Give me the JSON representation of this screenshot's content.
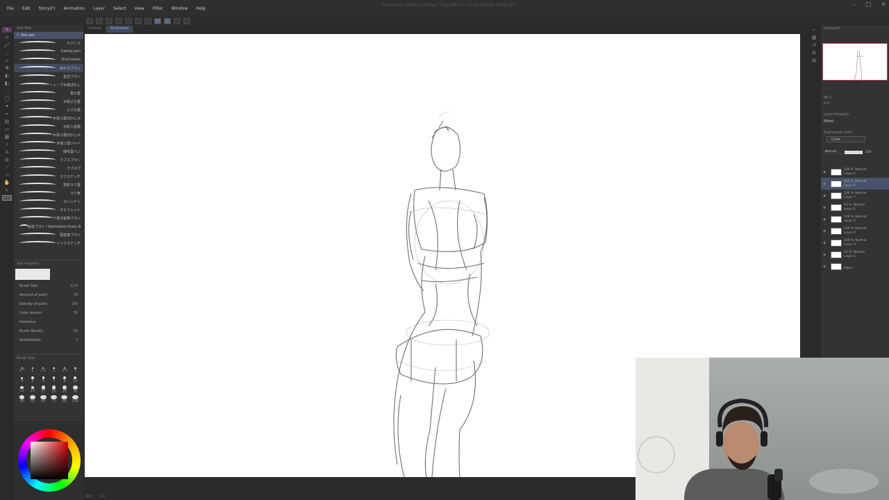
{
  "menu": {
    "items": [
      "File",
      "Edit",
      "Story(F)",
      "Animation",
      "Layer",
      "Select",
      "View",
      "Filter",
      "Window",
      "Help"
    ]
  },
  "window": {
    "title": "Illustration 1664 x 1784px 72dpi 88.7% - CLIP STUDIO PAINT EX"
  },
  "tabs": [
    "Untitled",
    "Illustration"
  ],
  "subtool": {
    "header": "Sub Tool",
    "selected": "Dot pen",
    "brushes": [
      {
        "name": "ネクシス"
      },
      {
        "name": "Gwang pen"
      },
      {
        "name": "DryClumps"
      },
      {
        "name": "ぬれホブラシ",
        "active": true
      },
      {
        "name": "星空ブラシ"
      },
      {
        "name": "シャープ木炭ぼかし"
      },
      {
        "name": "雲の雲"
      },
      {
        "name": "木炭ぶち雲"
      },
      {
        "name": "小さな雲"
      },
      {
        "name": "木炭ぶ雲ぼかしみ"
      },
      {
        "name": "水彩入道雲"
      },
      {
        "name": "木炭ぶ雲ぼかしみ"
      },
      {
        "name": "木炭ぶ雲ジャイ"
      },
      {
        "name": "綿毛雲ペン"
      },
      {
        "name": "ラフスブラシ"
      },
      {
        "name": "ラフスプ"
      },
      {
        "name": "ラフスケッチ"
      },
      {
        "name": "草原ラフ雲"
      },
      {
        "name": "ラフ気"
      },
      {
        "name": "ラハッゲン"
      },
      {
        "name": "ラエフェット"
      },
      {
        "name": "下書き鉛筆ブラシ"
      },
      {
        "name": "鉄道ブラシ / Battlefield Dusts B"
      },
      {
        "name": "雲密度ブラシ"
      },
      {
        "name": "インクスケッチ"
      }
    ]
  },
  "toolprop": {
    "header": "Tool Property",
    "rows": [
      {
        "label": "Brush Size",
        "value": "12.0"
      },
      {
        "label": "Amount of paint",
        "value": "78"
      },
      {
        "label": "Density of paint",
        "value": "100"
      },
      {
        "label": "Color stretch",
        "value": "35"
      },
      {
        "label": "Hardness",
        "value": ""
      },
      {
        "label": "Brush density",
        "value": "50"
      },
      {
        "label": "Stabilization",
        "value": "3"
      }
    ]
  },
  "brushsize": {
    "header": "Brush Size",
    "sizes": [
      "0.7",
      "1",
      "1.5",
      "2",
      "2.5",
      "3",
      "4",
      "5",
      "6",
      "7",
      "8",
      "10",
      "12",
      "15",
      "17",
      "20",
      "25",
      "30",
      "40",
      "50",
      "60",
      "70",
      "80",
      "100"
    ]
  },
  "navigator": {
    "header": "Navigator",
    "zoom": "88.7",
    "angle": "0.0"
  },
  "layer_panel": {
    "property_header": "Layer Property",
    "effect": "Effect",
    "expression_label": "Expression color",
    "expression_value": "Color",
    "blend_mode": "Normal",
    "opacity": "100",
    "layers": [
      {
        "opacity": "100 %",
        "mode": "Normal",
        "name": "Layer 2"
      },
      {
        "opacity": "100 %",
        "mode": "Normal",
        "name": "Layer 8",
        "active": true
      },
      {
        "opacity": "100 %",
        "mode": "Normal",
        "name": "Layer 7"
      },
      {
        "opacity": "51 %",
        "mode": "Normal",
        "name": "Layer 6"
      },
      {
        "opacity": "100 %",
        "mode": "Normal",
        "name": "Layer 5"
      },
      {
        "opacity": "100 %",
        "mode": "Normal",
        "name": "Layer 4"
      },
      {
        "opacity": "100 %",
        "mode": "Normal",
        "name": "Layer 3"
      },
      {
        "opacity": "51 %",
        "mode": "Normal",
        "name": "Layer 1"
      },
      {
        "opacity": "",
        "mode": "",
        "name": "Paper"
      }
    ]
  },
  "statusbar": {
    "zoom": "88.7",
    "angle": "0.0"
  },
  "colors": {
    "accent": "#c83c5a",
    "active_tool": "#e08ae0",
    "panel": "#333333"
  }
}
